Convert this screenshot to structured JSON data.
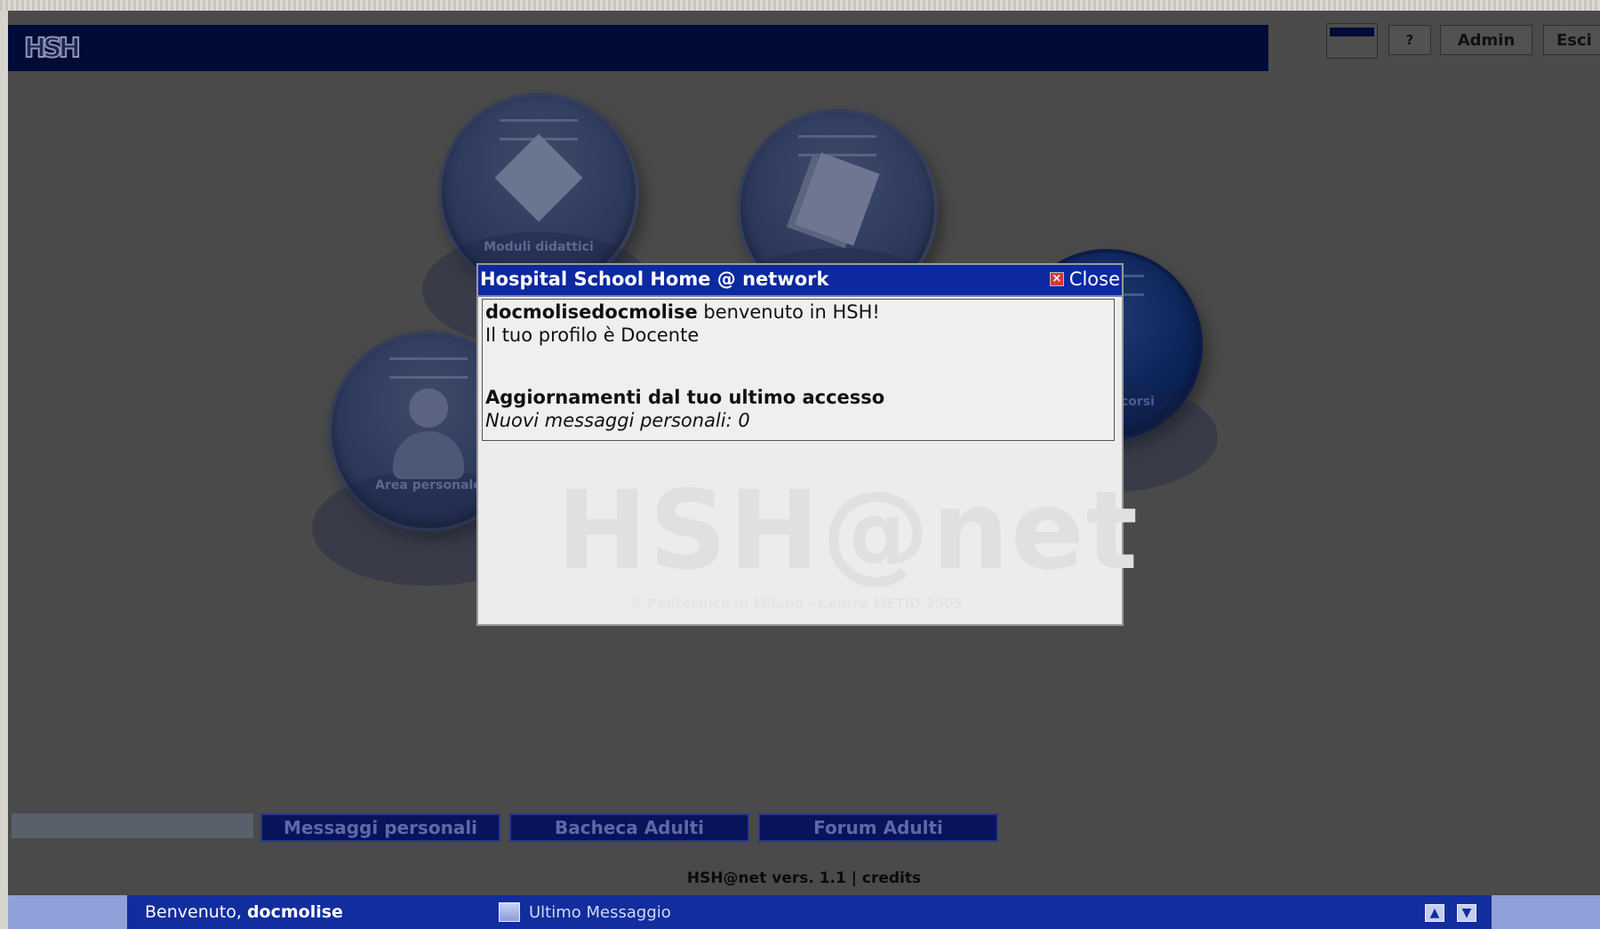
{
  "header": {
    "logo_text": "HSH",
    "buttons": {
      "help": "?",
      "admin": "Admin",
      "exit": "Esci"
    }
  },
  "modules": [
    {
      "label": "Moduli didattici"
    },
    {
      "label": ""
    },
    {
      "label": "Area personale"
    },
    {
      "label": "corsi"
    }
  ],
  "dialog": {
    "title": "Hospital School Home @ network",
    "close_label": "Close",
    "username": "docmolisedocmolise",
    "welcome_suffix": " benvenuto in HSH!",
    "profile_line": "Il tuo profilo è Docente",
    "updates_heading": "Aggiornamenti dal tuo ultimo accesso",
    "new_messages": "Nuovi messaggi personali: 0",
    "watermark": "HSH@net",
    "watermark_sub": "© Politecnico di Milano - Centro METID 2005"
  },
  "bottom_tabs": [
    "Messaggi personali",
    "Bacheca Adulti",
    "Forum Adulti"
  ],
  "footer": {
    "version": "HSH@net vers. 1.1 | ",
    "credits": "credits"
  },
  "statusbar": {
    "welcome_prefix": "Benvenuto, ",
    "username": "docmolise",
    "last_message_label": "Ultimo Messaggio"
  },
  "colors": {
    "header_bg": "#010b38",
    "dialog_title_bg": "#0c29a0",
    "statusbar_bg": "#122d9d",
    "tab_bg": "#08135c"
  }
}
